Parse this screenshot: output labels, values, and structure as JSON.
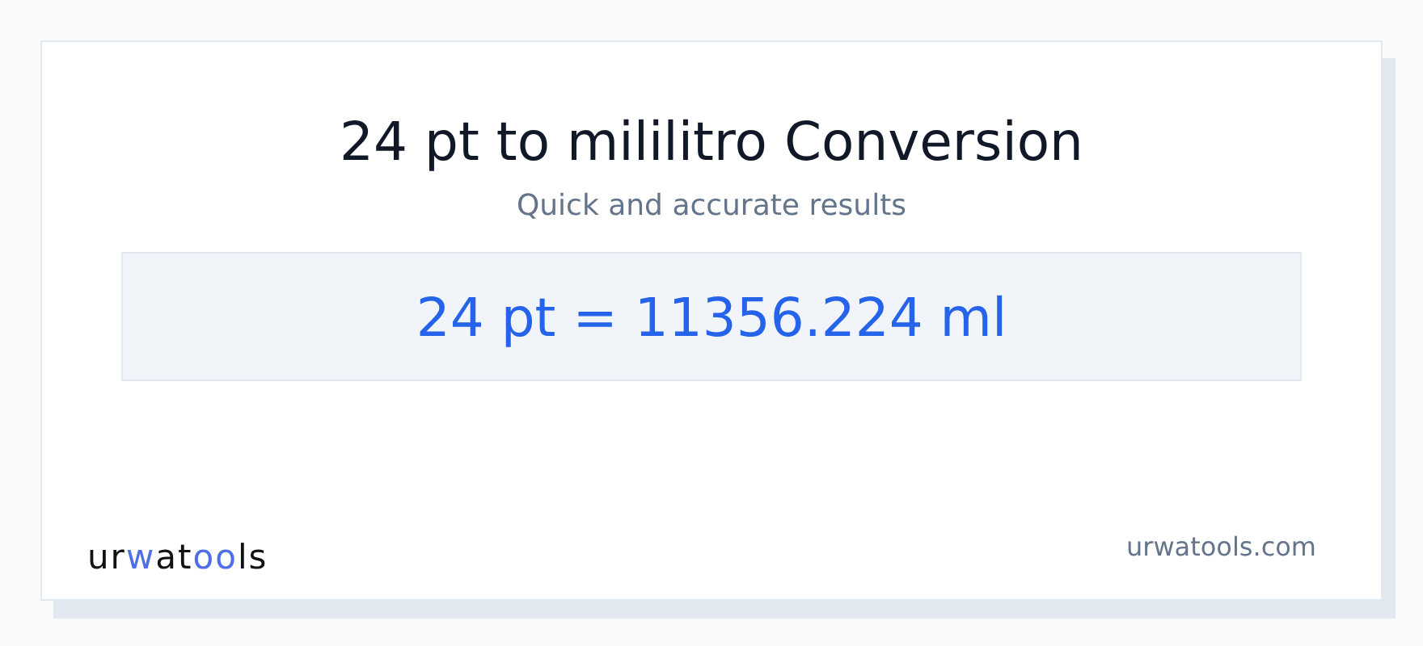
{
  "title": "24 pt to mililitro Conversion",
  "subtitle": "Quick and accurate results",
  "result": "24 pt = 11356.224 ml",
  "logo": [
    {
      "text": "ur",
      "accent": false
    },
    {
      "text": "w",
      "accent": true
    },
    {
      "text": "at",
      "accent": false
    },
    {
      "text": "oo",
      "accent": true
    },
    {
      "text": "ls",
      "accent": false
    }
  ],
  "site": "urwatools.com"
}
